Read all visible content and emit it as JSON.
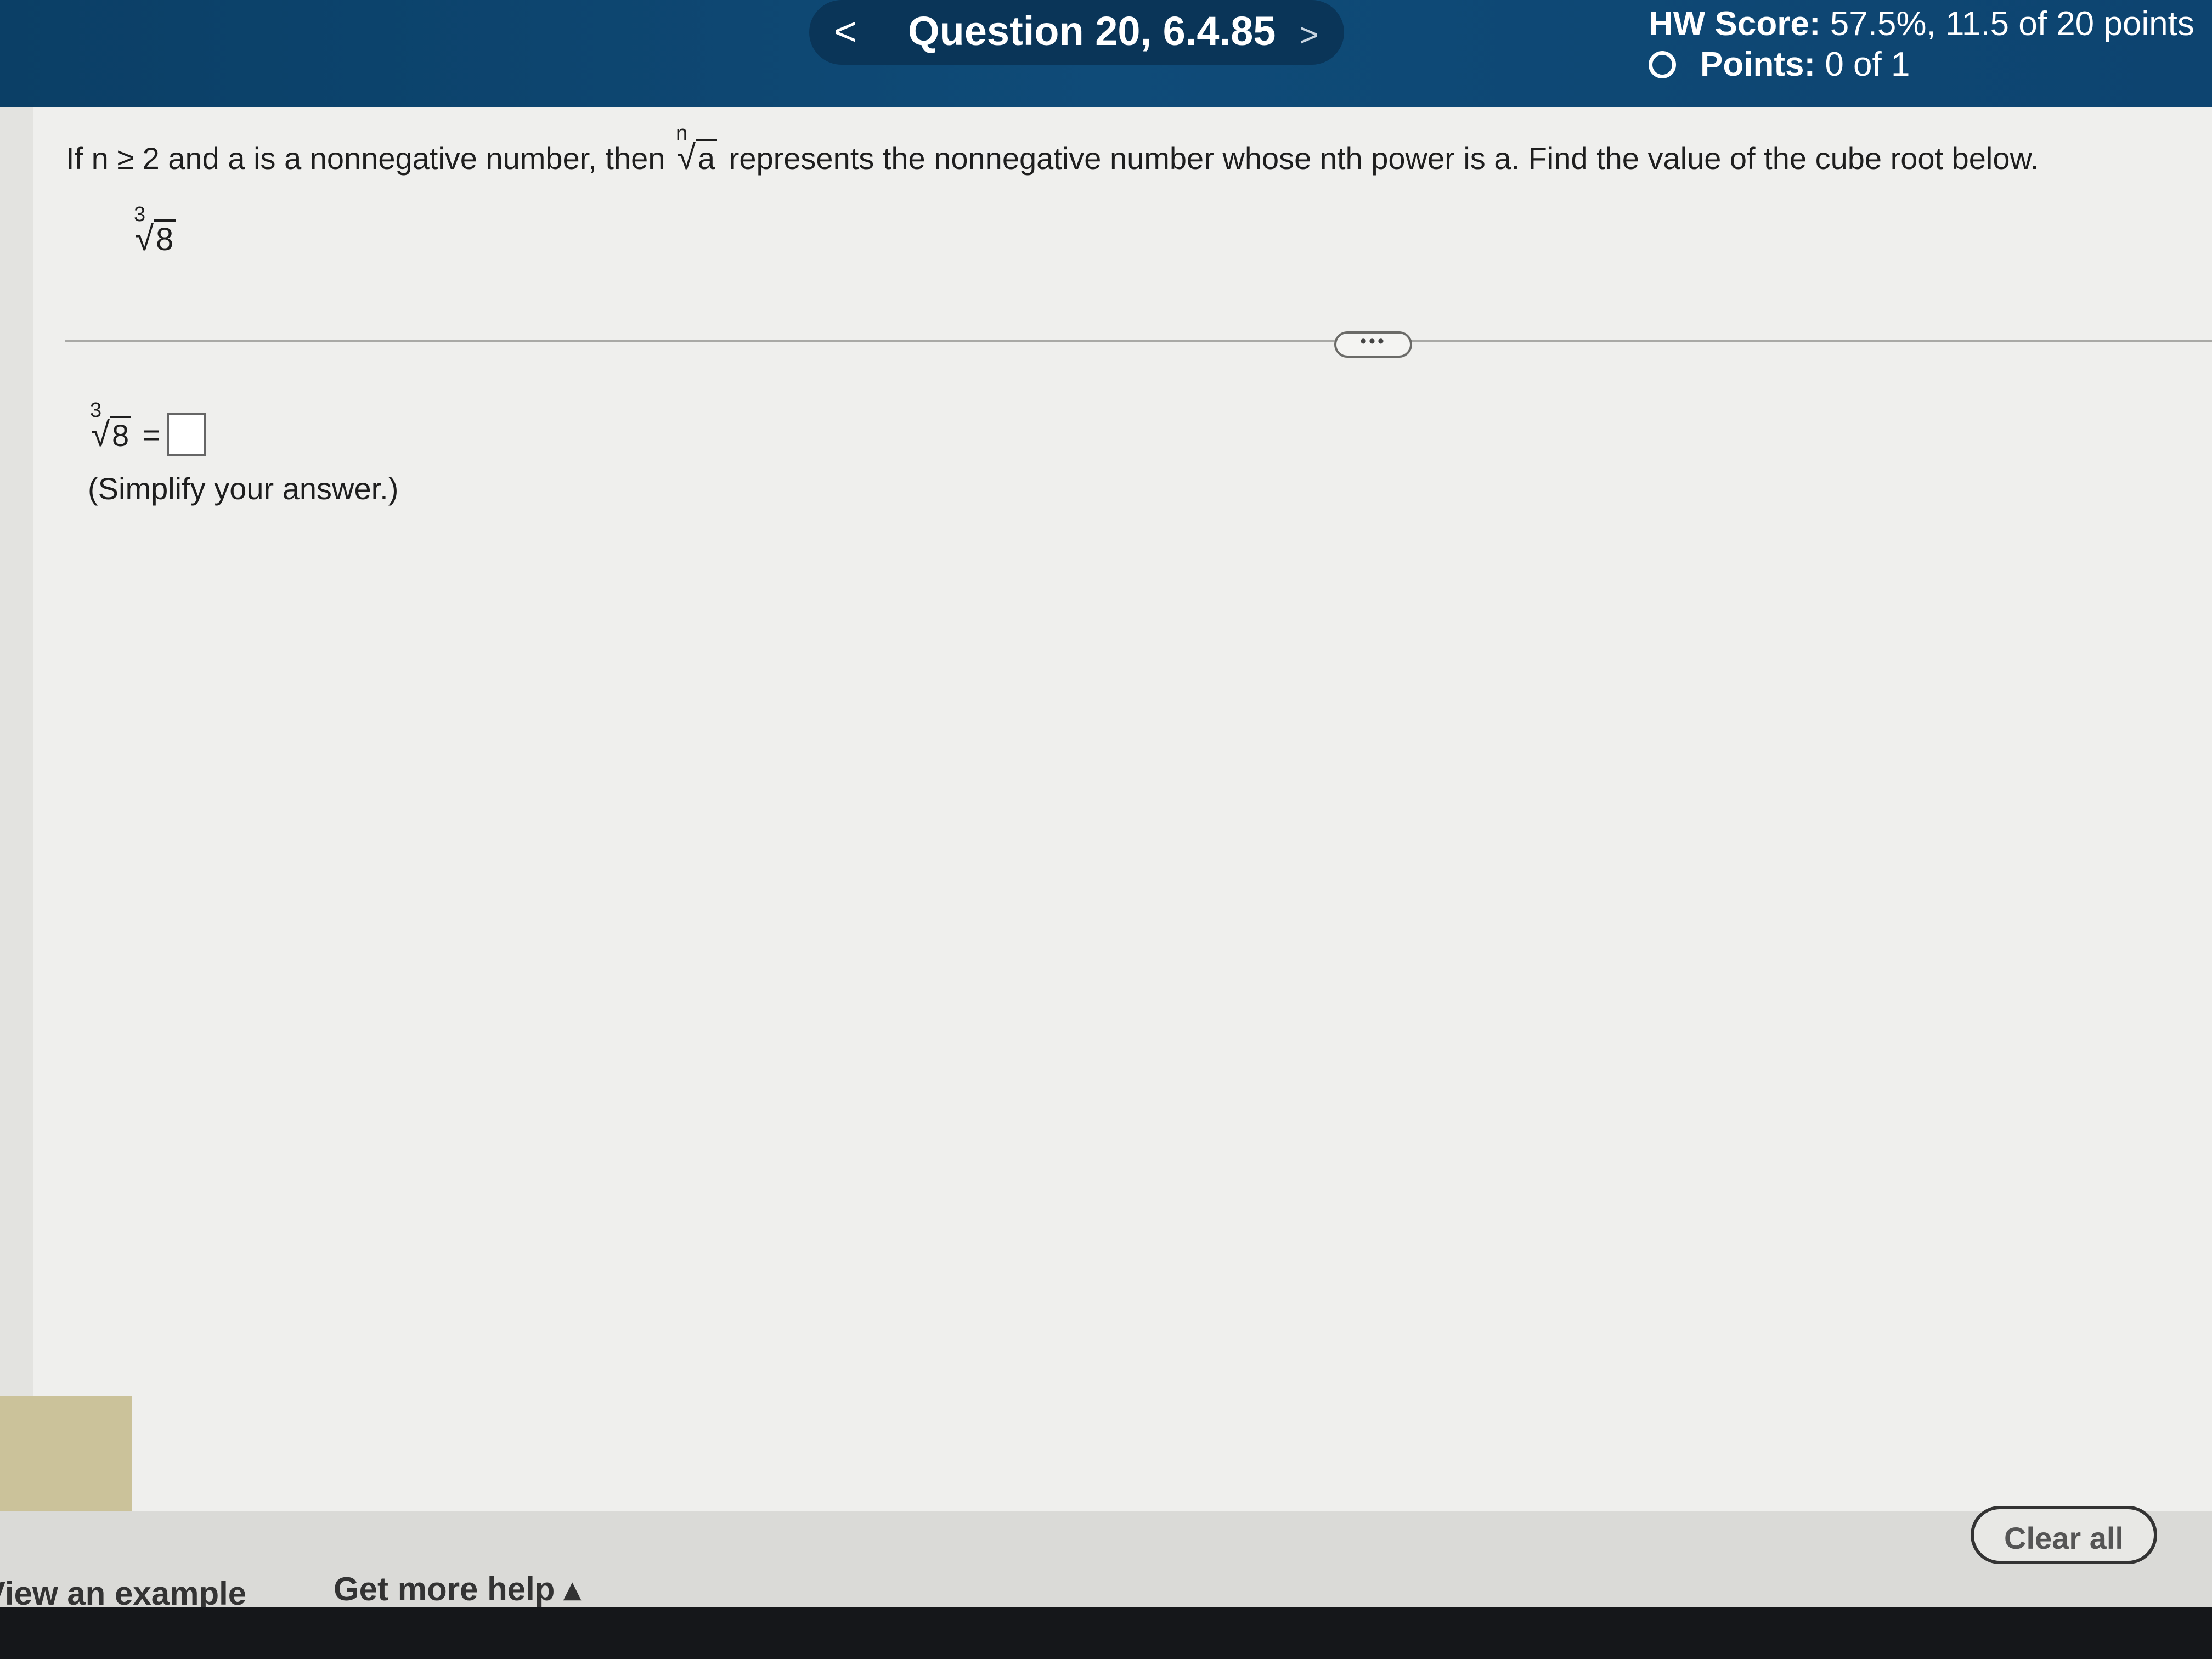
{
  "header": {
    "prev_label": "<",
    "title": "Question 20, 6.4.85",
    "next_label": ">",
    "hw_score_label": "HW Score:",
    "hw_score_value": "57.5%, 11.5 of 20 points",
    "points_label": "Points:",
    "points_value": "0 of 1",
    "bg_color": "#0f4b78"
  },
  "question": {
    "prompt_part1": "If n ≥ 2 and a is a nonnegative number, then",
    "prompt_radical_index": "n",
    "prompt_radical_radicand": "a",
    "prompt_part2": "represents the nonnegative number whose nth power is a. Find the value of the cube root below.",
    "expr_index": "3",
    "expr_radicand": "8",
    "more_label": "•••"
  },
  "answer": {
    "index": "3",
    "radicand": "8",
    "equals": "=",
    "value": "",
    "hint": "(Simplify your answer.)"
  },
  "footer": {
    "view_example": "View an example",
    "get_more_help": "Get more help ▴",
    "clear_all": "Clear all"
  },
  "icons": {
    "prev": "chevron-left-icon",
    "next": "chevron-right-icon",
    "points_status": "circle-outline-icon"
  }
}
